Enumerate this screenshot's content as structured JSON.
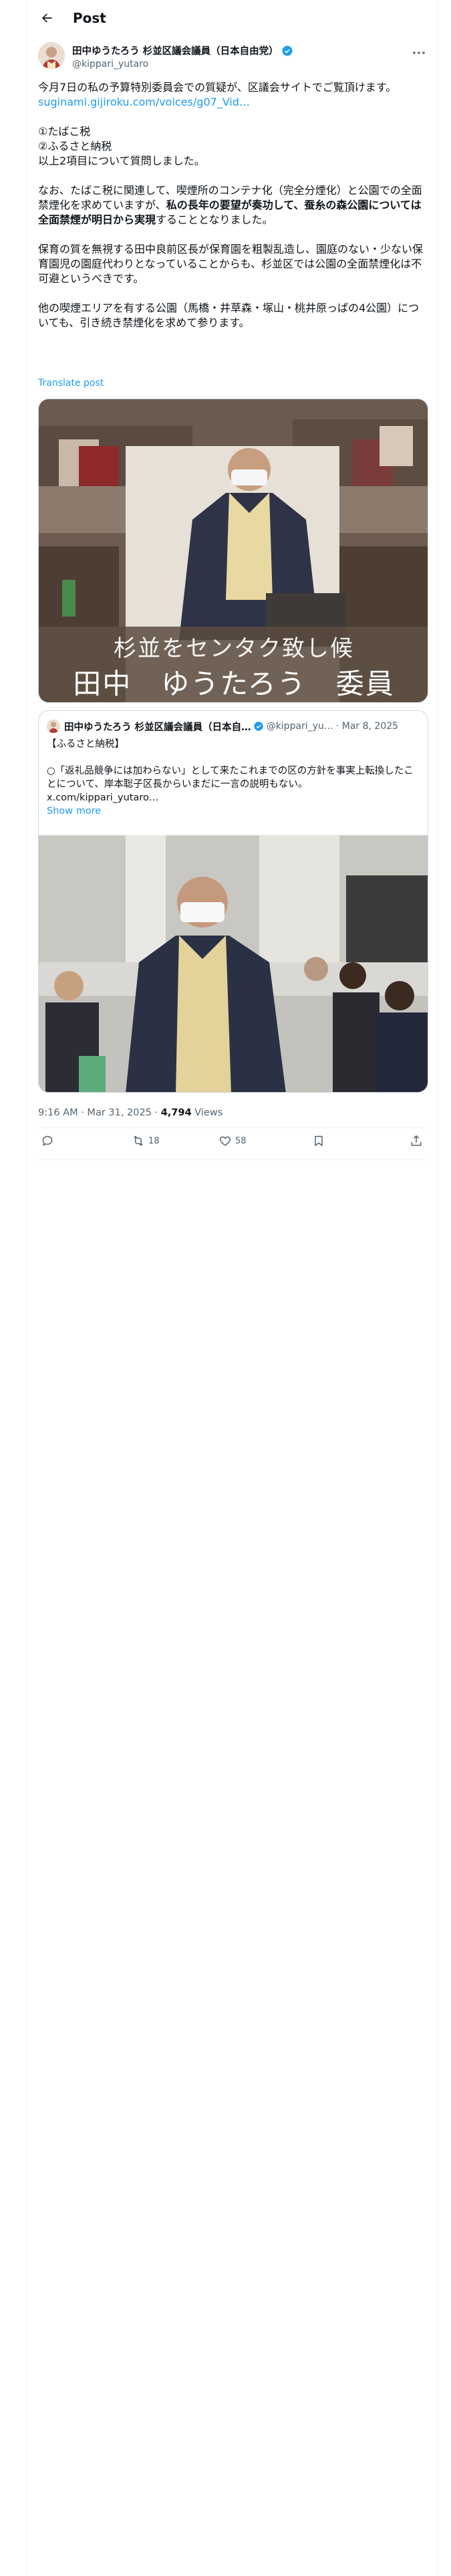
{
  "header": {
    "title": "Post"
  },
  "author": {
    "name": "田中ゆうたろう 杉並区議会議員（日本自由党）",
    "handle": "@kippari_yutaro"
  },
  "tweet": {
    "lines": [
      "今月7日の私の予算特別委員会での質疑が、区議会サイトでご覧頂けます。",
      "",
      "①たばこ税",
      "②ふるさと納税",
      "以上2項目について質問しました。"
    ],
    "link": "suginami.gijiroku.com/voices/g07_Vid…",
    "p2_a": "なお、たばこ税に関連して、喫煙所のコンテナ化（完全分煙化）と公園での全面禁煙化を求めていますが、",
    "p2_b": "私の長年の要望が奏功して、蚕糸の森公園については全面禁煙が明日から実現",
    "p2_c": "することとなりました。",
    "p3": "保育の質を無視する田中良前区長が保育園を粗製乱造し、園庭のない・少ない保育園児の園庭代わりとなっていることからも、杉並区では公園の全面禁煙化は不可避というべきです。",
    "p4": "他の喫煙エリアを有する公園（馬橋・井草森・塚山・桃井原っぱの4公園）についても、引き続き禁煙化を求めて参ります。",
    "translate": "Translate post"
  },
  "media": {
    "caption_top": "杉並をセンタク致し候",
    "caption_bottom": "田中　ゆうたろう　委員"
  },
  "quote": {
    "name": "田中ゆうたろう 杉並区議会議員（日本自…",
    "handle": "@kippari_yu…",
    "date": "· Mar 8, 2025",
    "line1": "【ふるさと納税】",
    "line2": "○「返礼品競争には加わらない」として来たこれまでの区の方針を事実上転換したことについて、岸本聡子区長からいまだに一言の説明もない。",
    "line3": "x.com/kippari_yutaro…",
    "show_more": "Show more"
  },
  "meta": {
    "time": "9:16 AM · Mar 31, 2025 · ",
    "views_count": "4,794",
    "views_label": " Views"
  },
  "actions": {
    "replies": "",
    "reposts": "18",
    "likes": "58"
  },
  "colors": {
    "accent": "#1d9bf0",
    "muted": "#536471",
    "text": "#0f1419"
  }
}
